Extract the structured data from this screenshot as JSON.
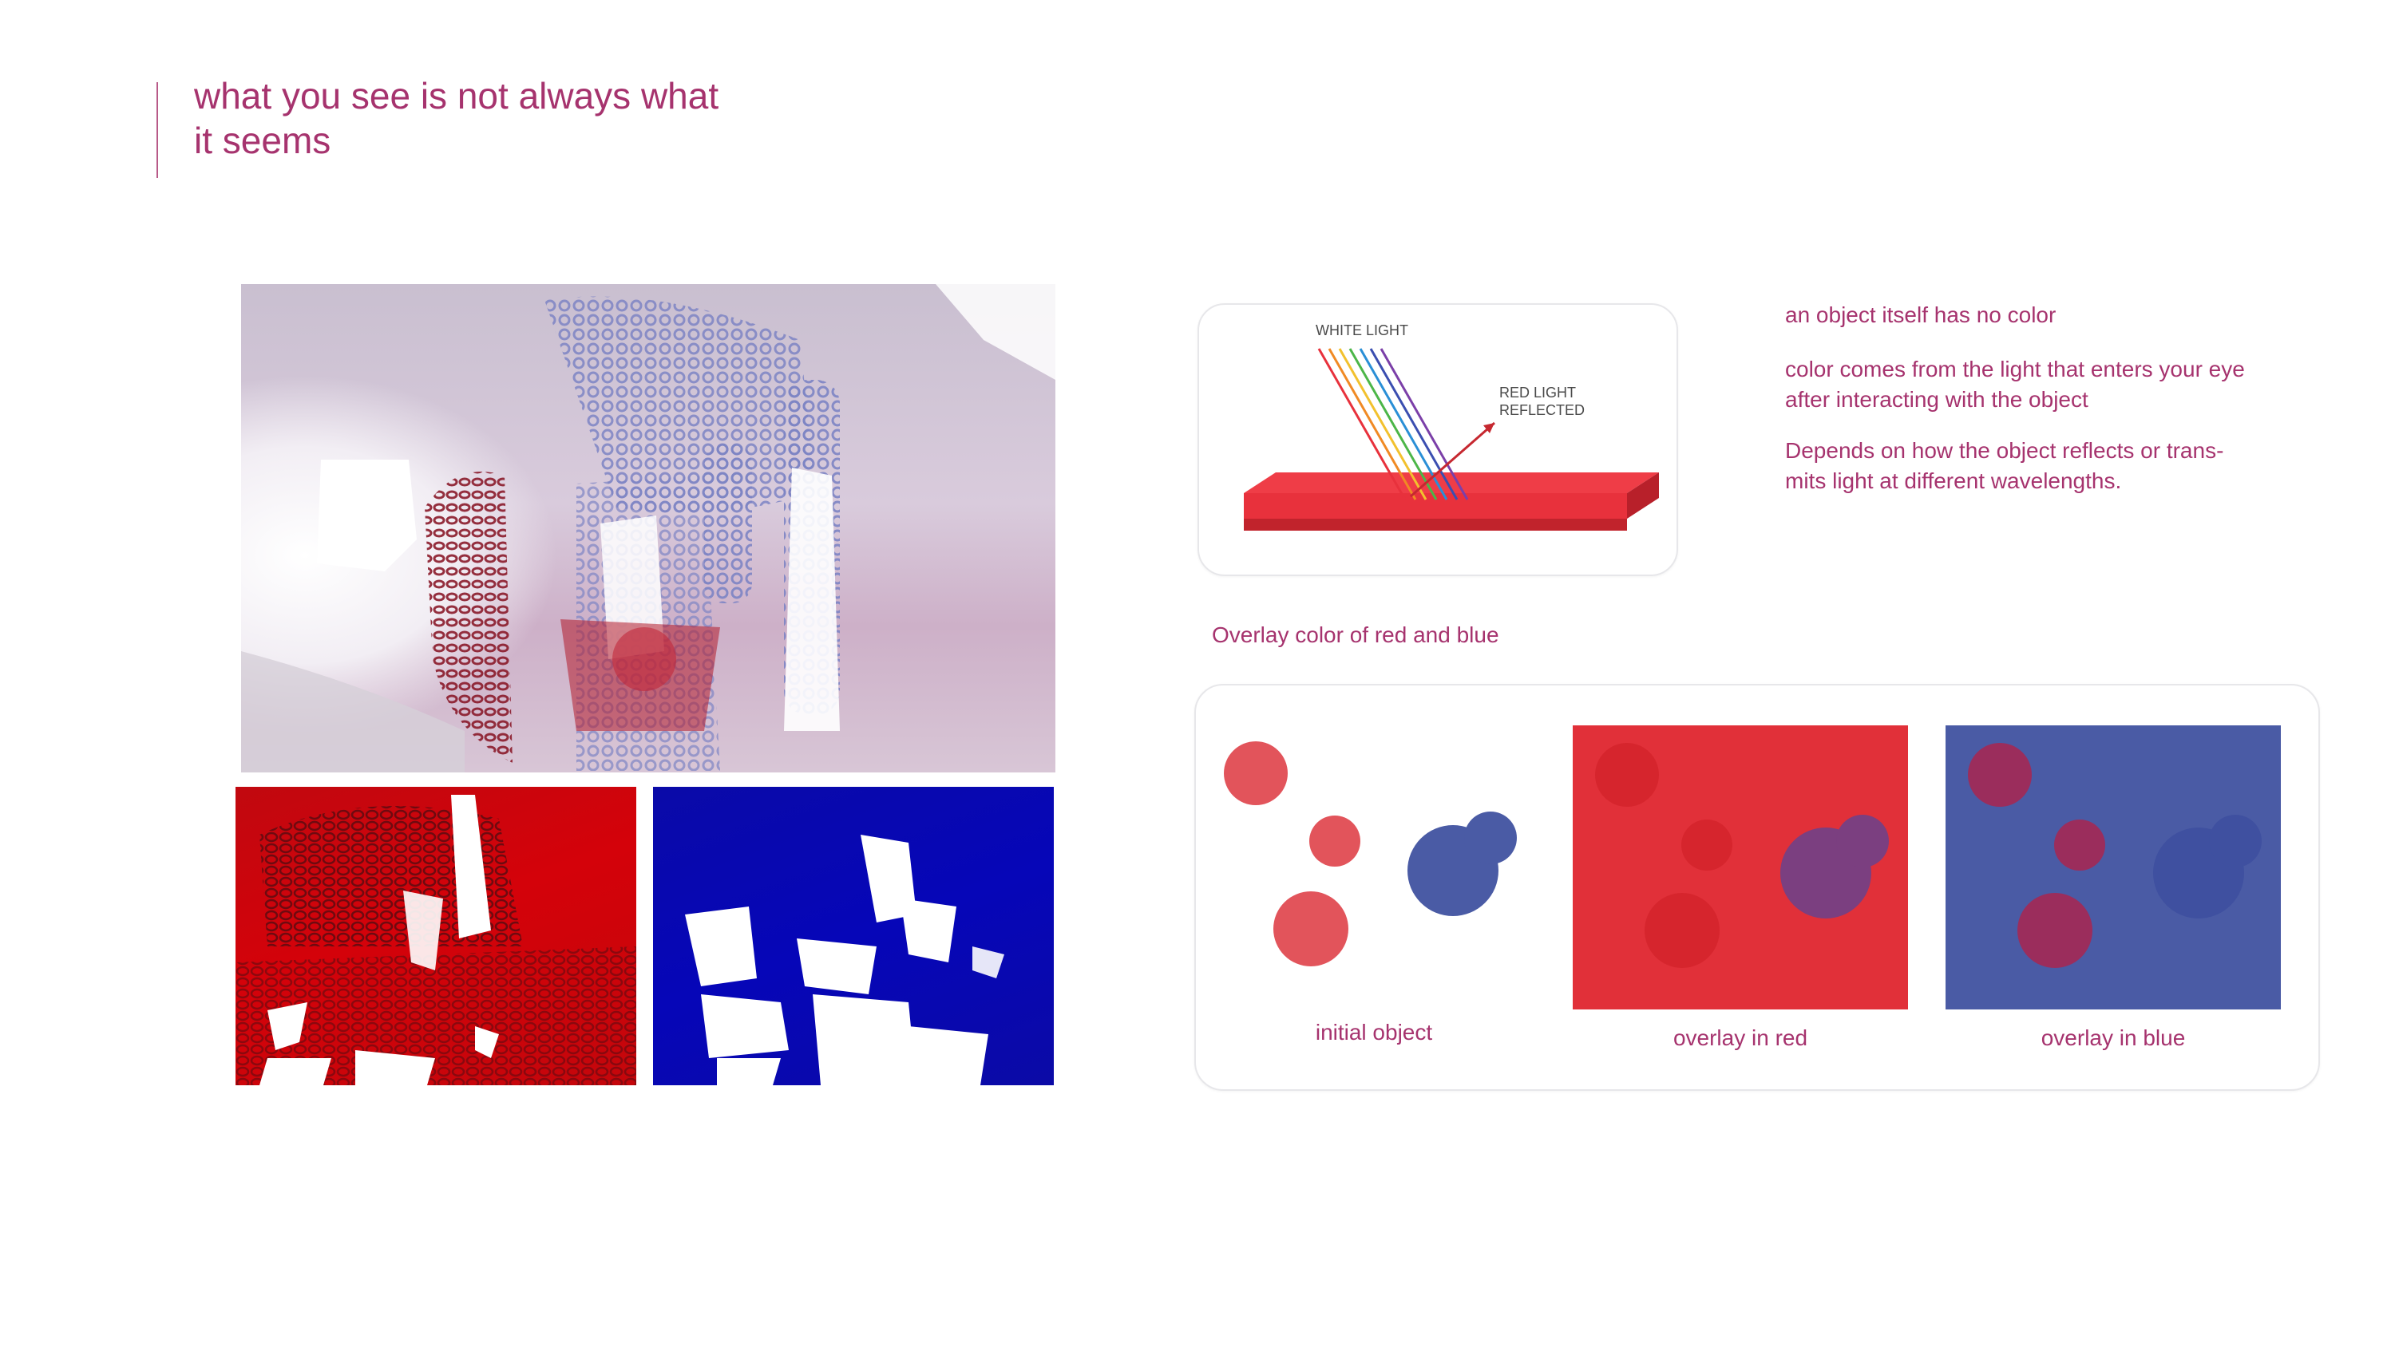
{
  "title": {
    "line1": "what you see is not always what",
    "line2": "it seems"
  },
  "colors": {
    "accent": "#a6336e",
    "red": "#e13039",
    "blue": "#4a5ba5"
  },
  "diagram": {
    "white_light_label": "WHITE LIGHT",
    "red_reflected_line1": "RED LIGHT",
    "red_reflected_line2": "REFLECTED"
  },
  "info": {
    "line1": "an object itself has no color",
    "line2a": "color comes from the light that enters your eye",
    "line2b": "after interacting with the object",
    "line3a": "Depends on how the object reflects or trans-",
    "line3b": "mits light at different wavelengths."
  },
  "overlay": {
    "caption": "Overlay color of red and blue",
    "initial_label": "initial object",
    "red_label": "overlay in red",
    "blue_label": "overlay in blue"
  }
}
